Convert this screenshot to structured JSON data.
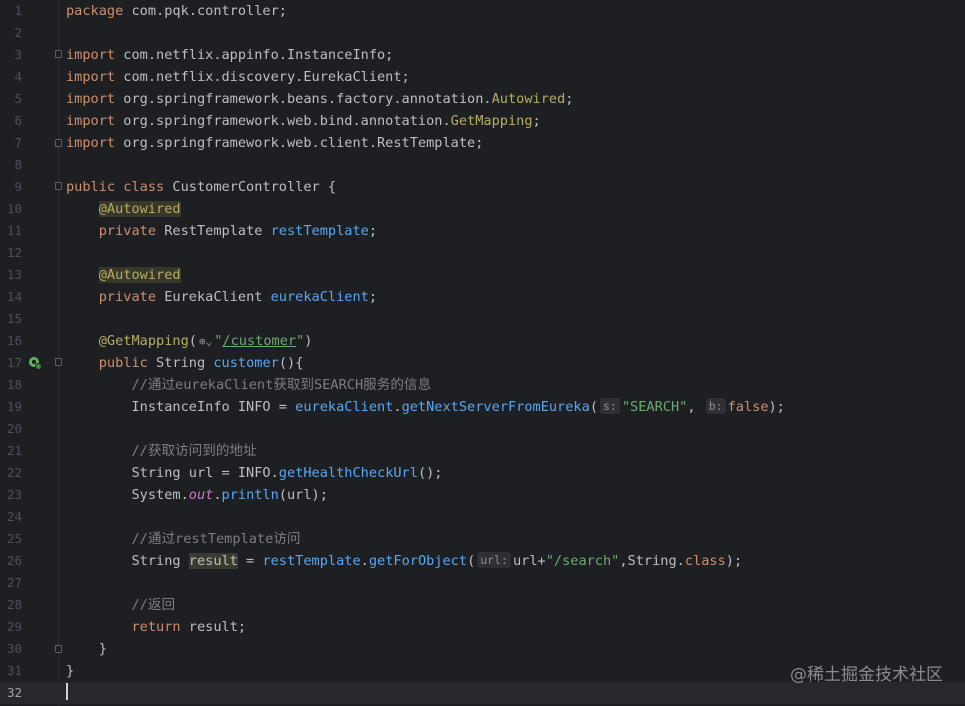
{
  "lines": [
    {
      "n": "1",
      "tokens": [
        [
          "kw",
          "package"
        ],
        [
          "",
          " com.pqk.controller;"
        ]
      ]
    },
    {
      "n": "2",
      "tokens": []
    },
    {
      "n": "3",
      "tokens": [
        [
          "kw",
          "import"
        ],
        [
          "",
          " com.netflix.appinfo.InstanceInfo;"
        ]
      ]
    },
    {
      "n": "4",
      "tokens": [
        [
          "kw",
          "import"
        ],
        [
          "",
          " com.netflix.discovery.EurekaClient;"
        ]
      ]
    },
    {
      "n": "5",
      "tokens": [
        [
          "kw",
          "import"
        ],
        [
          "",
          " org.springframework.beans.factory.annotation."
        ],
        [
          "ann",
          "Autowired"
        ],
        [
          "",
          ";"
        ]
      ]
    },
    {
      "n": "6",
      "tokens": [
        [
          "kw",
          "import"
        ],
        [
          "",
          " org.springframework.web.bind.annotation."
        ],
        [
          "ann",
          "GetMapping"
        ],
        [
          "",
          ";"
        ]
      ]
    },
    {
      "n": "7",
      "tokens": [
        [
          "kw",
          "import"
        ],
        [
          "",
          " org.springframework.web.client.RestTemplate;"
        ]
      ]
    },
    {
      "n": "8",
      "tokens": []
    },
    {
      "n": "9",
      "tokens": [
        [
          "kw",
          "public class"
        ],
        [
          "",
          " CustomerController {"
        ]
      ]
    },
    {
      "n": "10",
      "tokens": [
        [
          "",
          "    "
        ],
        [
          "annbg",
          "@Autowired"
        ]
      ]
    },
    {
      "n": "11",
      "tokens": [
        [
          "",
          "    "
        ],
        [
          "kw",
          "private"
        ],
        [
          "",
          " RestTemplate "
        ],
        [
          "fld",
          "restTemplate"
        ],
        [
          "",
          ";"
        ]
      ]
    },
    {
      "n": "12",
      "tokens": []
    },
    {
      "n": "13",
      "tokens": [
        [
          "",
          "    "
        ],
        [
          "annbg",
          "@Autowired"
        ]
      ]
    },
    {
      "n": "14",
      "tokens": [
        [
          "",
          "    "
        ],
        [
          "kw",
          "private"
        ],
        [
          "",
          " EurekaClient "
        ],
        [
          "fld",
          "eurekaClient"
        ],
        [
          "",
          ";"
        ]
      ]
    },
    {
      "n": "15",
      "tokens": []
    },
    {
      "n": "16",
      "tokens": [
        [
          "",
          "    "
        ],
        [
          "ann",
          "@GetMapping"
        ],
        [
          "",
          "("
        ],
        [
          "globe",
          "⊕⌄"
        ],
        [
          "str",
          "\""
        ],
        [
          "url",
          "/customer"
        ],
        [
          "str",
          "\""
        ],
        [
          "",
          ")"
        ]
      ]
    },
    {
      "n": "17",
      "tokens": [
        [
          "",
          "    "
        ],
        [
          "kw",
          "public"
        ],
        [
          "",
          " String "
        ],
        [
          "meth",
          "customer"
        ],
        [
          "",
          "(){"
        ]
      ]
    },
    {
      "n": "18",
      "tokens": [
        [
          "",
          "        "
        ],
        [
          "cmt",
          "//通过eurekaClient获取到SEARCH服务的信息"
        ]
      ]
    },
    {
      "n": "19",
      "tokens": [
        [
          "",
          "        InstanceInfo INFO = "
        ],
        [
          "fld",
          "eurekaClient"
        ],
        [
          "",
          "."
        ],
        [
          "meth",
          "getNextServerFromEureka"
        ],
        [
          "",
          "("
        ],
        [
          "hint",
          "s:"
        ],
        [
          "str",
          "\"SEARCH\""
        ],
        [
          "",
          ", "
        ],
        [
          "hint",
          "b:"
        ],
        [
          "kw",
          "false"
        ],
        [
          "",
          ");"
        ]
      ]
    },
    {
      "n": "20",
      "tokens": []
    },
    {
      "n": "21",
      "tokens": [
        [
          "",
          "        "
        ],
        [
          "cmt",
          "//获取访问到的地址"
        ]
      ]
    },
    {
      "n": "22",
      "tokens": [
        [
          "",
          "        String url = INFO."
        ],
        [
          "meth",
          "getHealthCheckUrl"
        ],
        [
          "",
          "();"
        ]
      ]
    },
    {
      "n": "23",
      "tokens": [
        [
          "",
          "        System."
        ],
        [
          "italic",
          "out"
        ],
        [
          "",
          "."
        ],
        [
          "meth",
          "println"
        ],
        [
          "",
          "(url);"
        ]
      ]
    },
    {
      "n": "24",
      "tokens": []
    },
    {
      "n": "25",
      "tokens": [
        [
          "",
          "        "
        ],
        [
          "cmt",
          "//通过restTemplate访问"
        ]
      ]
    },
    {
      "n": "26",
      "tokens": [
        [
          "",
          "        String "
        ],
        [
          "hl",
          "result"
        ],
        [
          "",
          " = "
        ],
        [
          "fld",
          "restTemplate"
        ],
        [
          "",
          "."
        ],
        [
          "meth",
          "getForObject"
        ],
        [
          "",
          "("
        ],
        [
          "hint",
          "url:"
        ],
        [
          "",
          "url+"
        ],
        [
          "str",
          "\"/search\""
        ],
        [
          "",
          ",String."
        ],
        [
          "kw",
          "class"
        ],
        [
          "",
          ");"
        ]
      ]
    },
    {
      "n": "27",
      "tokens": []
    },
    {
      "n": "28",
      "tokens": [
        [
          "",
          "        "
        ],
        [
          "cmt",
          "//返回"
        ]
      ]
    },
    {
      "n": "29",
      "tokens": [
        [
          "",
          "        "
        ],
        [
          "kw",
          "return"
        ],
        [
          "",
          " result;"
        ]
      ]
    },
    {
      "n": "30",
      "tokens": [
        [
          "",
          "    }"
        ]
      ]
    },
    {
      "n": "31",
      "tokens": [
        [
          "",
          "}"
        ]
      ]
    },
    {
      "n": "32",
      "tokens": [
        [
          "cursor",
          ""
        ]
      ]
    }
  ],
  "current_line": "32",
  "watermark": "@稀土掘金技术社区",
  "colors": {
    "background": "#1e1f22",
    "keyword": "#cf8e6d",
    "annotation": "#b3ae60",
    "string": "#6aab73",
    "field": "#56a8f5",
    "comment": "#7a7e85"
  }
}
